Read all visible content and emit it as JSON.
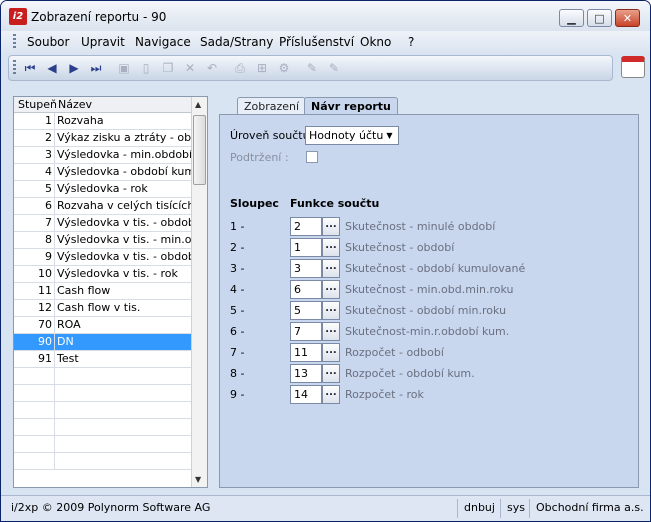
{
  "window": {
    "title": "Zobrazení reportu - 90",
    "icon_label": "i2"
  },
  "menu": [
    "Soubor",
    "Upravit",
    "Navigace",
    "Sada/Strany",
    "Příslušenství",
    "Okno",
    "?"
  ],
  "list": {
    "headers": {
      "num": "Stupeň",
      "name": "Název"
    },
    "rows": [
      {
        "num": "1",
        "name": "Rozvaha"
      },
      {
        "num": "2",
        "name": "Výkaz zisku a ztráty - obdob"
      },
      {
        "num": "3",
        "name": "Výsledovka - min.období"
      },
      {
        "num": "4",
        "name": "Výsledovka - období kumulo"
      },
      {
        "num": "5",
        "name": "Výsledovka - rok"
      },
      {
        "num": "6",
        "name": "Rozvaha v celých tisících"
      },
      {
        "num": "7",
        "name": "Výsledovka v tis. - období"
      },
      {
        "num": "8",
        "name": "Výsledovka v tis. - min.obdo"
      },
      {
        "num": "9",
        "name": "Výsledovka v tis. - období ku"
      },
      {
        "num": "10",
        "name": "Výsledovka v tis. - rok"
      },
      {
        "num": "11",
        "name": "Cash flow"
      },
      {
        "num": "12",
        "name": "Cash flow v tis."
      },
      {
        "num": "70",
        "name": "ROA"
      },
      {
        "num": "90",
        "name": "DN"
      },
      {
        "num": "91",
        "name": "Test"
      },
      {
        "num": "",
        "name": ""
      },
      {
        "num": "",
        "name": ""
      },
      {
        "num": "",
        "name": ""
      },
      {
        "num": "",
        "name": ""
      },
      {
        "num": "",
        "name": ""
      },
      {
        "num": "",
        "name": ""
      }
    ],
    "selected_index": 13
  },
  "tabs": {
    "inactive": "Zobrazení",
    "active": "Návr reportu"
  },
  "form": {
    "level_label": "Úroveň součtu:",
    "level_value": "Hodnoty účtu",
    "underline_label": "Podtržení  :",
    "col_header": "Sloupec",
    "func_header": "Funkce součtu",
    "dots": "...",
    "rows": [
      {
        "idx": "1 -",
        "value": "2",
        "desc": "Skutečnost - minulé období"
      },
      {
        "idx": "2 -",
        "value": "1",
        "desc": "Skutečnost - období"
      },
      {
        "idx": "3 -",
        "value": "3",
        "desc": "Skutečnost - období kumulované"
      },
      {
        "idx": "4 -",
        "value": "6",
        "desc": "Skutečnost - min.obd.min.roku"
      },
      {
        "idx": "5 -",
        "value": "5",
        "desc": "Skutečnost - období min.roku"
      },
      {
        "idx": "6 -",
        "value": "7",
        "desc": "Skutečnost-min.r.období kum."
      },
      {
        "idx": "7 -",
        "value": "11",
        "desc": "Rozpočet - odbobí"
      },
      {
        "idx": "8 -",
        "value": "13",
        "desc": "Rozpočet - období kum."
      },
      {
        "idx": "9 -",
        "value": "14",
        "desc": "Rozpočet - rok"
      }
    ]
  },
  "status": {
    "copyright": "i/2xp © 2009 Polynorm Software AG",
    "db": "dnbuj",
    "user": "sys",
    "company": "Obchodní firma a.s."
  }
}
